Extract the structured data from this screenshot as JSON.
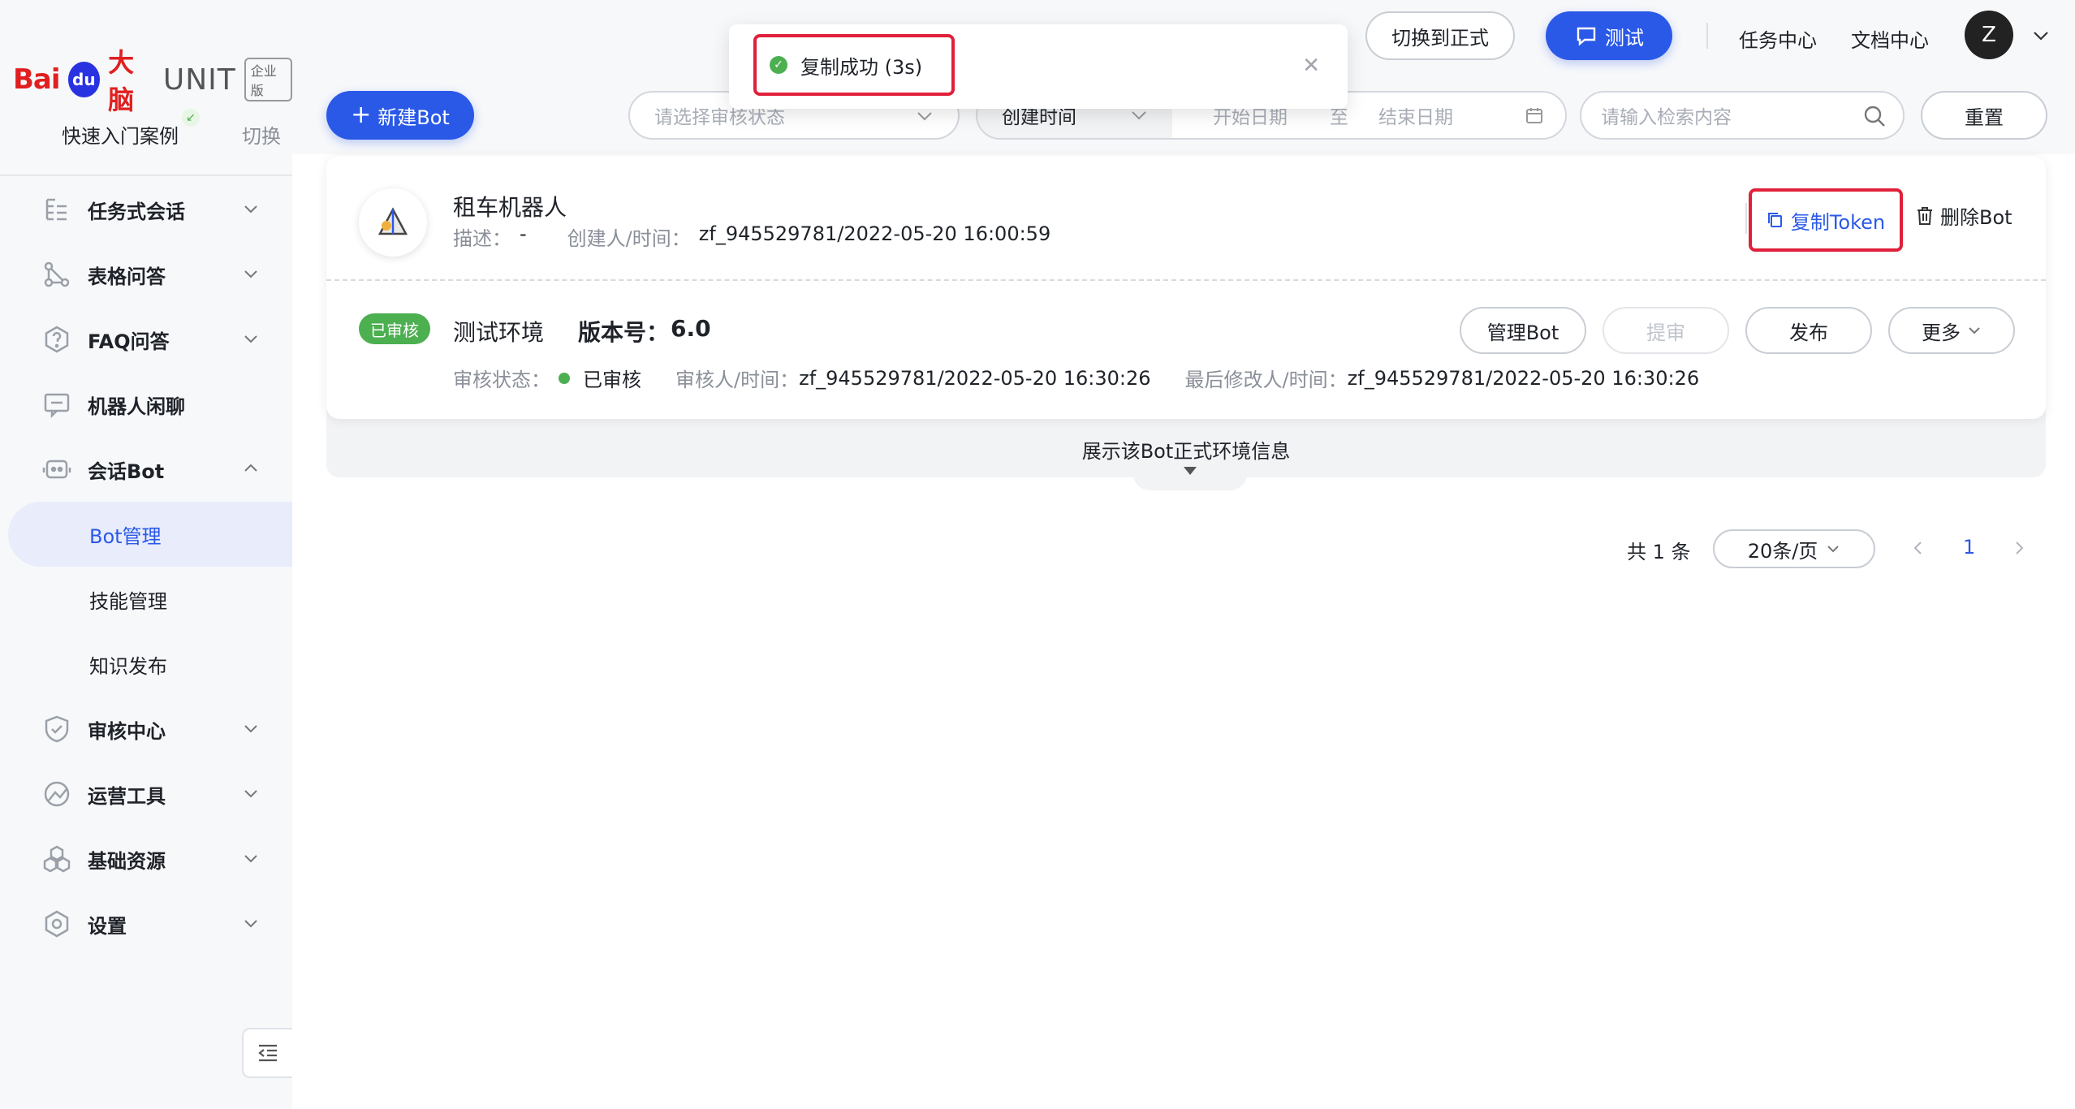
{
  "brand": {
    "logo_bai": "Bai",
    "logo_du": "du",
    "logo_danao": "大脑",
    "logo_unit": "UNIT",
    "logo_edition": "企业版"
  },
  "sidebar": {
    "quick_start": "快速入门案例",
    "switch": "切换",
    "items": [
      {
        "label": "任务式会话",
        "icon": "task-dialog-icon"
      },
      {
        "label": "表格问答",
        "icon": "table-qa-icon"
      },
      {
        "label": "FAQ问答",
        "icon": "faq-icon"
      },
      {
        "label": "机器人闲聊",
        "icon": "chat-icon"
      },
      {
        "label": "会话Bot",
        "icon": "bot-icon"
      },
      {
        "label": "审核中心",
        "icon": "shield-icon"
      },
      {
        "label": "运营工具",
        "icon": "operation-icon"
      },
      {
        "label": "基础资源",
        "icon": "resource-icon"
      },
      {
        "label": "设置",
        "icon": "settings-icon"
      }
    ],
    "sub_items": [
      "Bot管理",
      "技能管理",
      "知识发布"
    ]
  },
  "header": {
    "switch_formal": "切换到正式",
    "test": "测试",
    "task_center": "任务中心",
    "doc_center": "文档中心",
    "avatar_initial": "Z"
  },
  "toast": {
    "message": "复制成功 (3s)"
  },
  "toolbar": {
    "new_bot": "新建Bot",
    "review_status_placeholder": "请选择审核状态",
    "time_type": "创建时间",
    "start_date_placeholder": "开始日期",
    "date_sep": "至",
    "end_date_placeholder": "结束日期",
    "search_placeholder": "请输入检索内容",
    "reset": "重置"
  },
  "bot_card": {
    "name": "租车机器人",
    "desc_label": "描述：",
    "desc_value": "-",
    "creator_label": "创建人/时间：",
    "creator_value": "zf_945529781/2022-05-20 16:00:59",
    "copy_token": "复制Token",
    "delete_bot": "删除Bot",
    "env": {
      "status_badge": "已审核",
      "name": "测试环境",
      "version_label": "版本号：",
      "version_value": "6.0",
      "review_status_label": "审核状态：",
      "review_status_value": "已审核",
      "reviewer_label": "审核人/时间：",
      "reviewer_value": "zf_945529781/2022-05-20 16:30:26",
      "modifier_label": "最后修改人/时间：",
      "modifier_value": "zf_945529781/2022-05-20 16:30:26",
      "manage_bot": "管理Bot",
      "submit_review": "提审",
      "publish": "发布",
      "more": "更多"
    },
    "expand_text": "展示该Bot正式环境信息"
  },
  "pagination": {
    "total": "共 1 条",
    "page_size": "20条/页",
    "current_page": "1"
  },
  "colors": {
    "primary": "#2a59e8",
    "success": "#4caf50",
    "highlight_border": "#e0203a"
  }
}
